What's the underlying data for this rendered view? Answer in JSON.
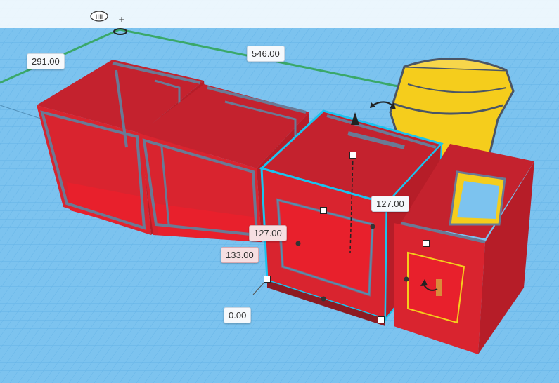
{
  "viewport": {
    "grid_color": "#7cc3ef",
    "accent_outline": "#19c4f0",
    "shape_color": "#e8202c",
    "bucket_color": "#f5cd1c"
  },
  "dimensions": {
    "width_left": "291.00",
    "length_top": "546.00",
    "selected_width": "127.00",
    "selected_depth": "127.00",
    "selected_height": "133.00",
    "elevation": "0.00"
  },
  "icons": {
    "workplane_origin": "origin-ruler-icon",
    "rotate_handle": "rotate-arrow-icon",
    "lift_handle": "lift-cone-icon"
  }
}
